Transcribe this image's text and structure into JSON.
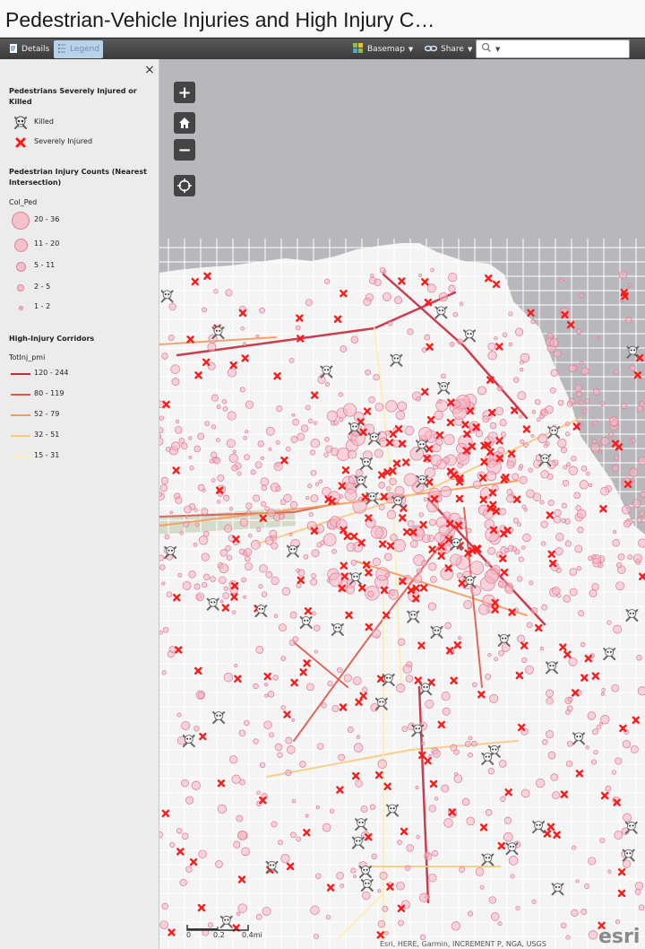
{
  "title": "Pedestrian-Vehicle Injuries and High Injury C…",
  "toolbar": {
    "details_label": "Details",
    "legend_label": "Legend",
    "basemap_label": "Basemap",
    "share_label": "Share",
    "search_placeholder": ""
  },
  "legend": {
    "close_symbol": "×",
    "sections": [
      {
        "heading": "Pedestrians Severely Injured or Killed",
        "items": [
          {
            "label": "Killed",
            "symbol": "skull-crossbones-icon"
          },
          {
            "label": "Severely Injured",
            "symbol": "red-x-icon"
          }
        ]
      },
      {
        "heading": "Pedestrian Injury Counts (Nearest Intersection)",
        "field": "Col_Ped",
        "items": [
          {
            "label": "20 - 36"
          },
          {
            "label": "11 - 20"
          },
          {
            "label": "5 - 11"
          },
          {
            "label": "2 - 5"
          },
          {
            "label": "1 - 2"
          }
        ]
      },
      {
        "heading": "High-Injury Corridors",
        "field": "TotInj_pmi",
        "items": [
          {
            "label": "120 - 244",
            "color": "#c8283c"
          },
          {
            "label": "80 - 119",
            "color": "#e0554a"
          },
          {
            "label": "52 - 79",
            "color": "#f59a5a"
          },
          {
            "label": "32 - 51",
            "color": "#f9c97f"
          },
          {
            "label": "15 - 31",
            "color": "#fbedb5"
          }
        ]
      }
    ]
  },
  "map": {
    "controls": {
      "zoom_in": "+",
      "zoom_out": "−"
    },
    "scale_labels": [
      "0",
      "0.2",
      "0.4mi"
    ],
    "attribution": "Esri, HERE, Garmin, INCREMENT P, NGA, USGS",
    "logo_text": "esri"
  },
  "colors": {
    "accent": "#ff1a1a",
    "water": "#b8b8bc",
    "land": "#f4f4f4",
    "legend_active": "#b9d2ea"
  }
}
